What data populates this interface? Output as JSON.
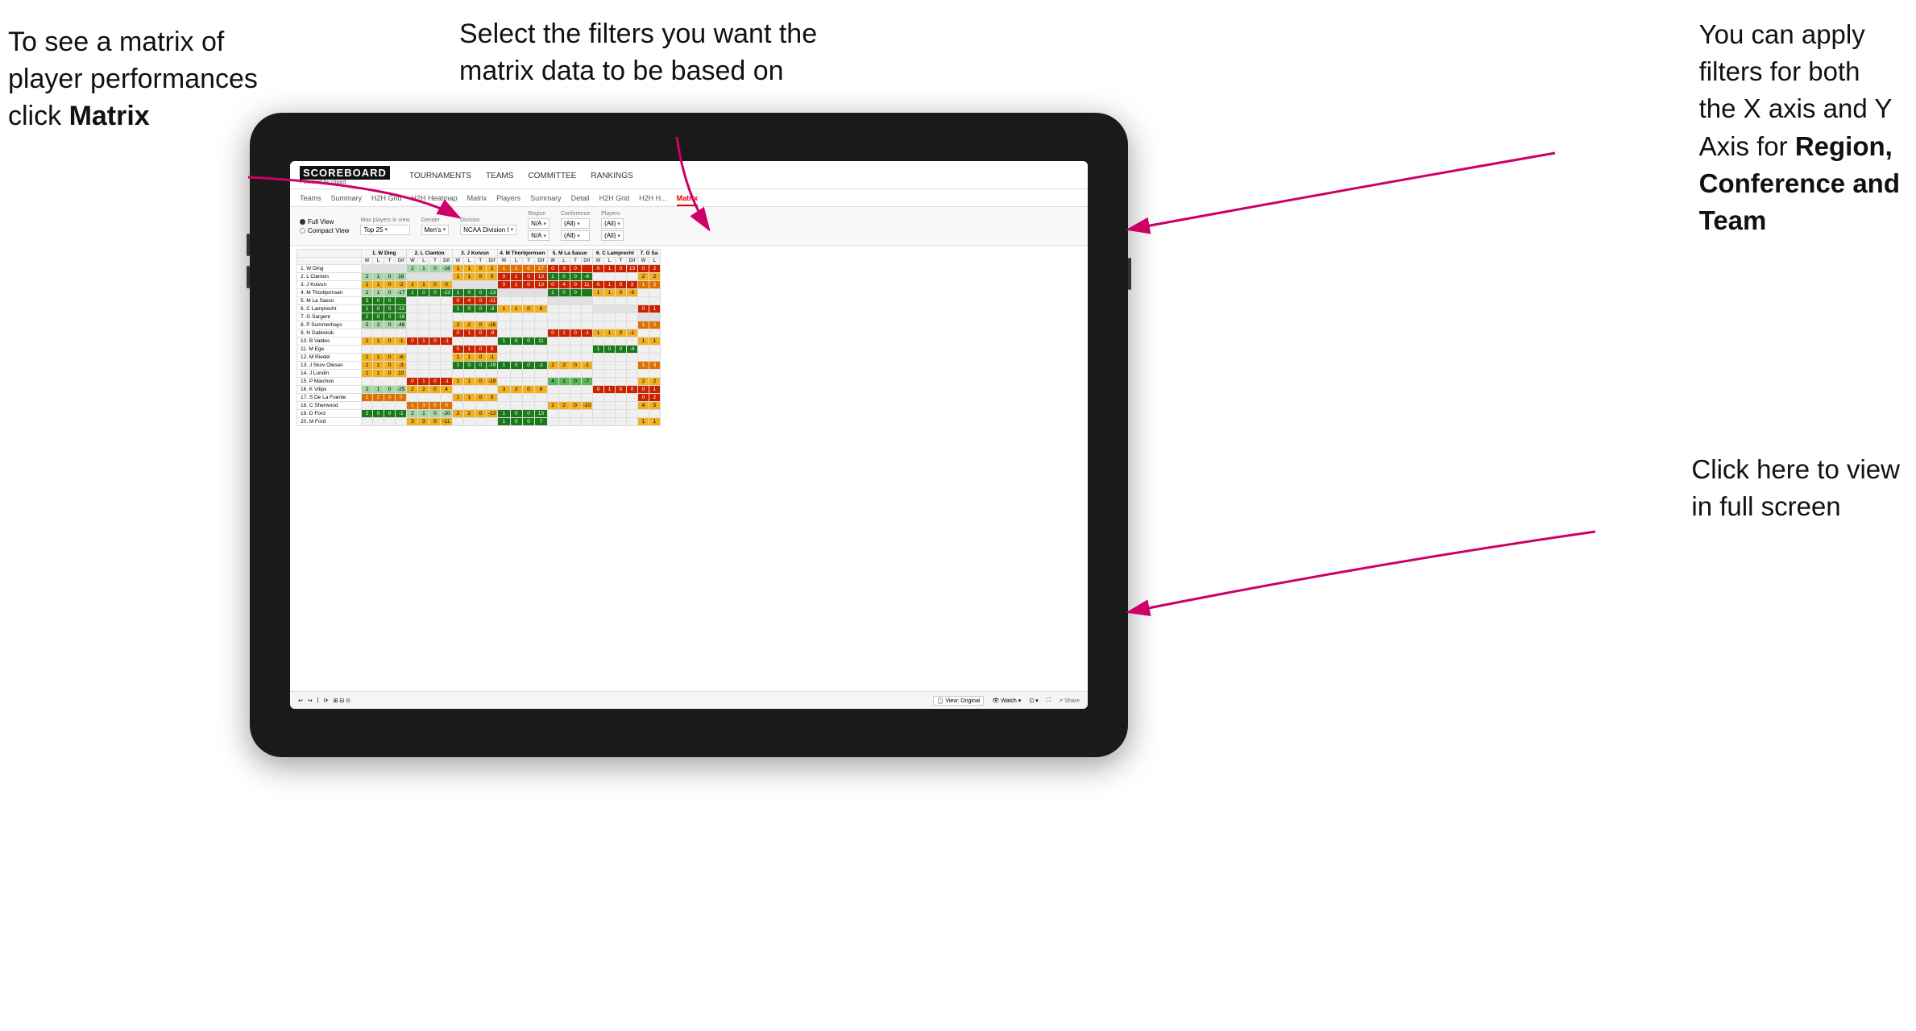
{
  "annotations": {
    "top_left": {
      "line1": "To see a matrix of",
      "line2": "player performances",
      "line3_plain": "click ",
      "line3_bold": "Matrix"
    },
    "top_center": {
      "text": "Select the filters you want the\nmatrix data to be based on"
    },
    "top_right": {
      "line1": "You  can apply",
      "line2": "filters for both",
      "line3": "the X axis and Y",
      "line4_plain": "Axis for ",
      "line4_bold": "Region,",
      "line5_bold": "Conference and",
      "line6_bold": "Team"
    },
    "bottom_right": {
      "line1": "Click here to view",
      "line2": "in full screen"
    }
  },
  "nav": {
    "logo_title": "SCOREBOARD",
    "logo_sub": "Powered by clippd",
    "items": [
      "TOURNAMENTS",
      "TEAMS",
      "COMMITTEE",
      "RANKINGS"
    ]
  },
  "sub_nav": {
    "items": [
      "Teams",
      "Summary",
      "H2H Grid",
      "H2H Heatmap",
      "Matrix",
      "Players",
      "Summary",
      "Detail",
      "H2H Grid",
      "H2H H...",
      "Matrix"
    ],
    "active": "Matrix"
  },
  "filters": {
    "view_options": [
      "Full View",
      "Compact View"
    ],
    "selected_view": "Full View",
    "max_players": {
      "label": "Max players in view",
      "value": "Top 25"
    },
    "gender": {
      "label": "Gender",
      "value": "Men's"
    },
    "division": {
      "label": "Division",
      "value": "NCAA Division I"
    },
    "region": {
      "label": "Region",
      "value_top": "N/A",
      "value_bottom": "N/A"
    },
    "conference": {
      "label": "Conference",
      "value_top": "(All)",
      "value_bottom": "(All)"
    },
    "players": {
      "label": "Players",
      "value_top": "(All)",
      "value_bottom": "(All)"
    }
  },
  "matrix": {
    "col_headers": [
      "1. W Ding",
      "2. L Clanton",
      "3. J Koivun",
      "4. M Thorbjornsen",
      "5. M La Sasso",
      "6. C Lamprecht",
      "7. G Sa"
    ],
    "sub_headers": [
      "W",
      "L",
      "T",
      "Dif"
    ],
    "rows": [
      {
        "label": "1. W Ding",
        "cells": "diagonal"
      },
      {
        "label": "2. L Clanton",
        "cells": "data"
      },
      {
        "label": "3. J Koivun",
        "cells": "data"
      },
      {
        "label": "4. M Thorbjornsen",
        "cells": "data"
      },
      {
        "label": "5. M La Sasso",
        "cells": "data"
      },
      {
        "label": "6. C Lamprecht",
        "cells": "data"
      },
      {
        "label": "7. G Sargent",
        "cells": "data"
      },
      {
        "label": "8. P Summerhays",
        "cells": "data"
      },
      {
        "label": "9. N Gabrelcik",
        "cells": "data"
      },
      {
        "label": "10. B Valdes",
        "cells": "data"
      },
      {
        "label": "11. M Ege",
        "cells": "data"
      },
      {
        "label": "12. M Riedel",
        "cells": "data"
      },
      {
        "label": "13. J Skov Olesen",
        "cells": "data"
      },
      {
        "label": "14. J Lundin",
        "cells": "data"
      },
      {
        "label": "15. P Maichon",
        "cells": "data"
      },
      {
        "label": "16. K Vilips",
        "cells": "data"
      },
      {
        "label": "17. S De La Fuente",
        "cells": "data"
      },
      {
        "label": "18. C Sherwood",
        "cells": "data"
      },
      {
        "label": "19. D Ford",
        "cells": "data"
      },
      {
        "label": "20. M Ford",
        "cells": "data"
      }
    ]
  },
  "toolbar": {
    "view_label": "View: Original",
    "watch_label": "Watch",
    "share_label": "Share"
  }
}
